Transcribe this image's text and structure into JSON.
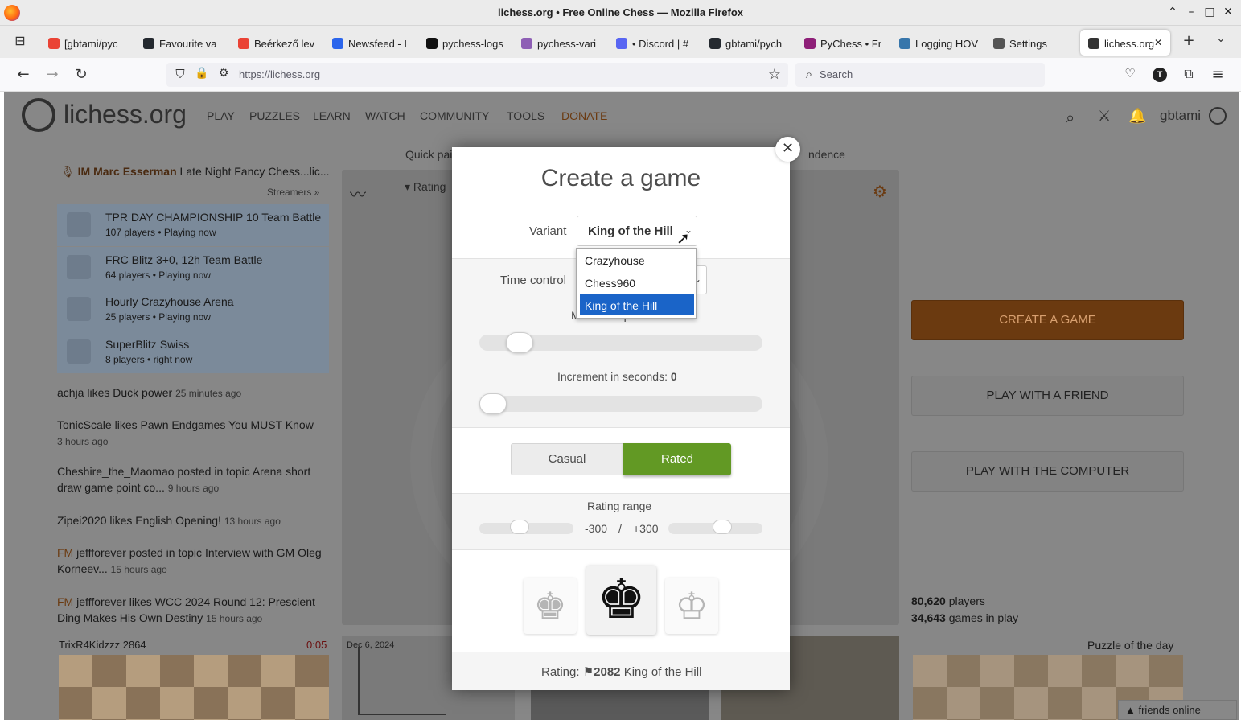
{
  "window": {
    "title": "lichess.org • Free Online Chess — Mozilla Firefox"
  },
  "tabs": [
    {
      "label": "[gbtami/pyc",
      "color": "#ea4335"
    },
    {
      "label": "Favourite va",
      "color": "#24292f"
    },
    {
      "label": "Beérkező lev",
      "color": "#ea4335"
    },
    {
      "label": "Newsfeed - I",
      "color": "#2b65ec"
    },
    {
      "label": "pychess-logs",
      "color": "#111111"
    },
    {
      "label": "pychess-vari",
      "color": "#8e5fb5"
    },
    {
      "label": "• Discord | #",
      "color": "#5865f2"
    },
    {
      "label": "gbtami/pych",
      "color": "#24292f"
    },
    {
      "label": "PyChess • Fr",
      "color": "#8e1f78"
    },
    {
      "label": "Logging HOV",
      "color": "#3776ab"
    },
    {
      "label": "Settings",
      "color": "#555555"
    },
    {
      "label": "lichess.org",
      "color": "#333333"
    }
  ],
  "nav": {
    "url": "https://lichess.org",
    "search_placeholder": "Search",
    "profile_letter": "T"
  },
  "site": {
    "logo": "lichess.org",
    "menu": [
      "PLAY",
      "PUZZLES",
      "LEARN",
      "WATCH",
      "COMMUNITY",
      "TOOLS",
      "DONATE"
    ],
    "user": "gbtami",
    "lobby_tabs_left": "Quick pai",
    "lobby_tabs_right": "ndence",
    "rating_label": "Rating"
  },
  "streamer": {
    "title": "IM",
    "name": "Marc Esserman",
    "text": "Late Night Fancy Chess...lic...",
    "link": "Streamers »"
  },
  "tournaments": [
    {
      "name": "TPR DAY CHAMPIONSHIP 10 Team Battle",
      "info": "107 players • Playing now"
    },
    {
      "name": "FRC Blitz 3+0, 12h Team Battle",
      "info": "64 players • Playing now"
    },
    {
      "name": "Hourly Crazyhouse Arena",
      "info": "25 players • Playing now"
    },
    {
      "name": "SuperBlitz Swiss",
      "info": "8 players •",
      "info2": "right now"
    }
  ],
  "feed": [
    {
      "user": "achja",
      "verb": "likes",
      "what": "Duck power",
      "time": "25 minutes ago"
    },
    {
      "user": "TonicScale",
      "verb": "likes",
      "what": "Pawn Endgames You MUST Know",
      "time": "3 hours ago"
    },
    {
      "user": "Cheshire_the_Maomao",
      "verb": "posted in topic",
      "what": "Arena short draw game point co...",
      "time": "9 hours ago"
    },
    {
      "user": "Zipei2020",
      "verb": "likes",
      "what": "English Opening!",
      "time": "13 hours ago"
    },
    {
      "title": "FM",
      "user": "jeffforever",
      "verb": "posted in topic",
      "what": "Interview with GM Oleg Korneev...",
      "time": "15 hours ago"
    },
    {
      "title": "FM",
      "user": "jeffforever",
      "verb": "likes",
      "what": "WCC 2024 Round 12: Prescient Ding Makes His Own Destiny",
      "time": "15 hours ago"
    }
  ],
  "right": {
    "create": "CREATE A GAME",
    "friend": "PLAY WITH A FRIEND",
    "computer": "PLAY WITH THE COMPUTER",
    "players": "80,620",
    "players_label": "players",
    "games": "34,643",
    "games_label": "games in play"
  },
  "bottom": {
    "tv_player": "TrixR4Kidzzz",
    "tv_rating": "2864",
    "tv_clock": "0:05",
    "blog_date": "Dec 6, 2024",
    "puzzle_label": "Puzzle of the day",
    "friends": "friends online"
  },
  "modal": {
    "title": "Create a game",
    "variant_label": "Variant",
    "variant_value": "King of the Hill",
    "variant_options": [
      "Crazyhouse",
      "Chess960",
      "King of the Hill"
    ],
    "time_control_label": "Time control",
    "minutes_label_partial": "M",
    "minutes_label_partial2": "p",
    "increment_label": "Increment in seconds:",
    "increment_value": "0",
    "casual": "Casual",
    "rated": "Rated",
    "rating_range_label": "Rating range",
    "range_min": "-300",
    "range_sep": "/",
    "range_max": "+300",
    "rating_prefix": "Rating:",
    "rating_value": "2082",
    "rating_variant": "King of the Hill"
  },
  "colors": {
    "accent": "#bf5000",
    "rated_green": "#629924",
    "select_blue": "#1a64c8"
  }
}
